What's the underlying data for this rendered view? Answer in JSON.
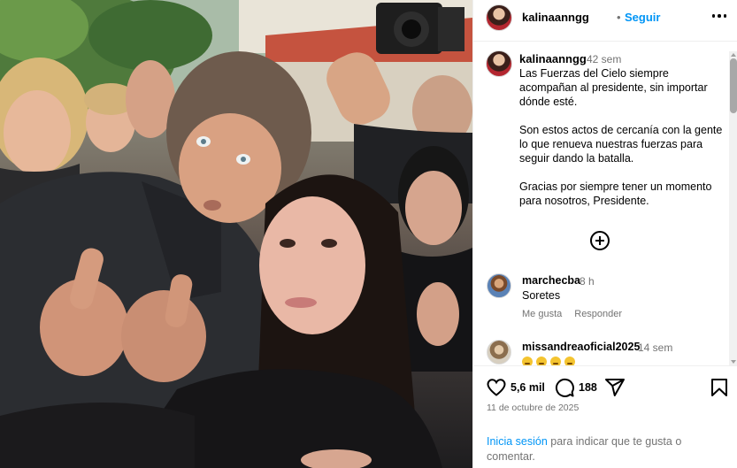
{
  "post": {
    "username": "kalinaanngg",
    "follow_label": "Seguir",
    "separator": "•",
    "caption": {
      "age": "42 sem",
      "text": "Las Fuerzas del Cielo siempre acompañan al presidente, sin importar dónde esté.\n\nSon estos actos de cercanía con la gente lo que renueva nuestras fuerzas para seguir dando la batalla.\n\nGracias por siempre tener un momento para nosotros, Presidente."
    },
    "comments": [
      {
        "username": "marchecba",
        "age": "8 h",
        "text": "Soretes",
        "like_label": "Me gusta",
        "reply_label": "Responder"
      },
      {
        "username": "missandreaoficial2025",
        "age": "14 sem",
        "emoji": [
          "grimacing-face-emoji",
          "grimacing-face-emoji",
          "grimacing-face-emoji",
          "grimacing-face-emoji"
        ]
      }
    ],
    "likes": "5,6 mil",
    "comment_count": "188",
    "date": "11 de octubre de 2025",
    "login_link": "Inicia sesión",
    "login_text": " para indicar que te gusta o comentar."
  },
  "icons": {
    "more": "more-options-icon",
    "add_comment": "plus-circle-icon",
    "like": "heart-icon",
    "comment": "comment-bubble-icon",
    "share": "send-icon",
    "save": "bookmark-icon"
  },
  "colors": {
    "link": "#0095f6",
    "muted": "#737373",
    "divider": "#efefef"
  }
}
